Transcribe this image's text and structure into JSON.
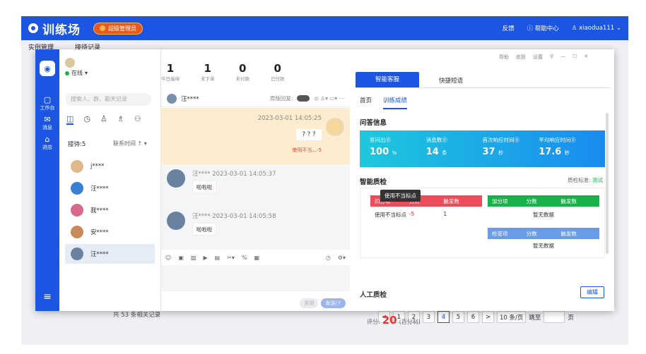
{
  "topbar": {
    "logo": "训练场",
    "admin_badge": "超级管理员",
    "feedback": "反馈",
    "help": "帮助中心",
    "user": "xiaodua111"
  },
  "bg": {
    "tab1": "实例管理",
    "tab2": "接待记录",
    "footer": "共 53 条相关记录"
  },
  "pager": {
    "pages": [
      "<",
      "1",
      "2",
      "3",
      "4",
      "5",
      "6",
      ">"
    ],
    "per_page": "10 条/页",
    "goto": "跳至",
    "page_unit": "页"
  },
  "rail": {
    "workbench": "工作台",
    "messages": "消息",
    "shop": "进店"
  },
  "status": {
    "online": "在线"
  },
  "search": {
    "placeholder": "搜索人、群、聊天记录"
  },
  "list": {
    "reception": "接待:5",
    "sort": "联系时间 ↑ ▾",
    "contacts": [
      "j****",
      "汪****",
      "我****",
      "安****",
      "汪****"
    ]
  },
  "stats": [
    {
      "n": "1",
      "l": "今日接待"
    },
    {
      "n": "1",
      "l": "未下单"
    },
    {
      "n": "0",
      "l": "未付款"
    },
    {
      "n": "0",
      "l": "已付款"
    }
  ],
  "chat": {
    "name": "汪****",
    "toggle_label": "原版回复:",
    "ts1": "2023-03-01 14:05:25",
    "q": "? ? ?",
    "tag": "使用不当...-5",
    "m1_meta": "汪****  2023-03-01 14:05:37",
    "m1": "啦啦啦",
    "m2_meta": "汪****  2023-03-01 14:05:58",
    "m2": "啦啦啦",
    "close": "关闭",
    "send": "发送(↑"
  },
  "window_ctrl": {
    "help": "帮助",
    "skin": "皮肤",
    "settings": "设置"
  },
  "panel": {
    "tab_ai": "智能客服",
    "tab_quick": "快捷短语",
    "sub_home": "首页",
    "sub_train": "训练成绩",
    "qa_title": "问答信息",
    "metrics": [
      {
        "l": "答问出⓪",
        "v": "100",
        "u": "%"
      },
      {
        "l": "消息数⓪",
        "v": "14",
        "u": "条"
      },
      {
        "l": "首次响应时间⓪",
        "v": "37",
        "u": "秒"
      },
      {
        "l": "平均响应时间⓪",
        "v": "17.6",
        "u": "秒"
      }
    ],
    "smart_title": "智能质检",
    "std_label": "质检标准:",
    "std_val": "测试",
    "tooltip": "使用不当标点",
    "deduct_head": [
      "扣分项",
      "分数",
      "触发数"
    ],
    "deduct_row": [
      "使用不当标点",
      "-5",
      "1"
    ],
    "add_head": [
      "加分项",
      "分数",
      "触发数"
    ],
    "none": "暂无数据",
    "check_head": [
      "检查项",
      "分数",
      "触发数"
    ],
    "manual_title": "人工质检",
    "edit": "编辑",
    "score_label": "评分:",
    "score": "20",
    "score_unit": "(百分制)"
  }
}
